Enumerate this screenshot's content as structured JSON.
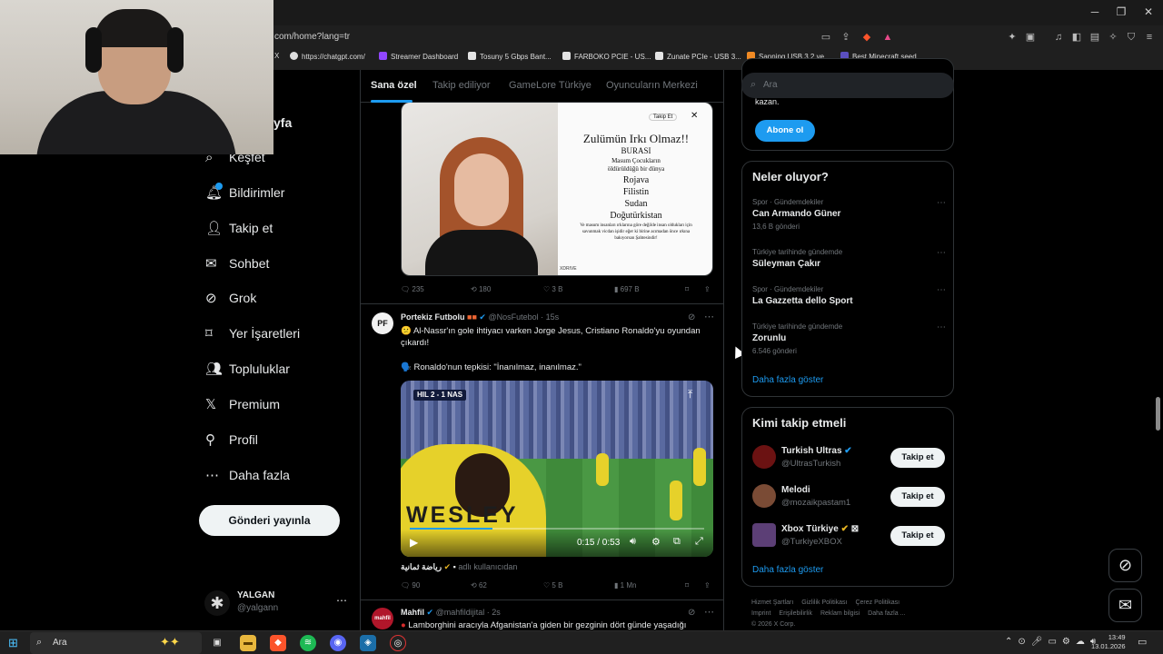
{
  "browser": {
    "url": "com/home?lang=tr",
    "bookmarks": [
      {
        "label": "X",
        "color": "#222222"
      },
      {
        "label": "https://chatgpt.com/",
        "color": "#10a37f"
      },
      {
        "label": "Streamer Dashboard",
        "color": "#9146ff"
      },
      {
        "label": "Tosuny 5 Gbps Bant...",
        "color": "#e3e3e3"
      },
      {
        "label": "FARBOKO PCIE - US...",
        "color": "#e3e3e3"
      },
      {
        "label": "Zunate PCIe - USB 3...",
        "color": "#e3e3e3"
      },
      {
        "label": "Sanning USB 3.2 ve...",
        "color": "#f08a24"
      },
      {
        "label": "Best Minecraft seed...",
        "color": "#5b4fbf"
      }
    ]
  },
  "nav": {
    "partial_label": "yfa",
    "items": [
      {
        "label": "Keşfet",
        "icon": "search-icon",
        "glyph": "⌕"
      },
      {
        "label": "Bildirimler",
        "icon": "bell-icon",
        "glyph": "🔔︎"
      },
      {
        "label": "Takip et",
        "icon": "follow-icon",
        "glyph": "👤︎"
      },
      {
        "label": "Sohbet",
        "icon": "mail-icon",
        "glyph": "✉"
      },
      {
        "label": "Grok",
        "icon": "grok-icon",
        "glyph": "⊘"
      },
      {
        "label": "Yer İşaretleri",
        "icon": "bookmark-icon",
        "glyph": "⌑"
      },
      {
        "label": "Topluluklar",
        "icon": "communities-icon",
        "glyph": "👥︎"
      },
      {
        "label": "Premium",
        "icon": "x-logo-icon",
        "glyph": "𝕏"
      },
      {
        "label": "Profil",
        "icon": "profile-icon",
        "glyph": "⚲"
      },
      {
        "label": "Daha fazla",
        "icon": "more-icon",
        "glyph": "⋯"
      }
    ],
    "post_button": "Gönderi yayınla",
    "account": {
      "name": "YALGAN",
      "handle": "@yalgann"
    }
  },
  "feed": {
    "tabs": [
      "Sana özel",
      "Takip ediliyor",
      "GameLore Türkiye",
      "Oyuncuların Merkezi"
    ],
    "post1": {
      "image_text": {
        "title": "Zulümün Irkı Olmaz!!",
        "lines": [
          "BURASI",
          "Masum Çocukların",
          "öldürüldüğü bir dünya",
          "Rojava",
          "Filistin",
          "Sudan",
          "Doğutürkistan"
        ],
        "foot": "Ve masum insanları ırklarına göre değilde insan oldukları için savunmak vicdan işidir eğer ki birine acımadan önce ırkına bakıyorsan Şahtesindir!",
        "follow": "Takip Et",
        "watermark": "XDRIVE"
      },
      "stats": {
        "replies": "235",
        "reposts": "180",
        "likes": "3 B",
        "views": "697 B"
      }
    },
    "post2": {
      "name": "Portekiz Futbolu",
      "handle": "@NosFutebol",
      "time": "15s",
      "text1": "😕 Al-Nassr'ın gole ihtiyacı varken Jorge Jesus, Cristiano Ronaldo'yu oyundan çıkardı!",
      "text2": "🗣️ Ronaldo'nun tepkisi: \"İnanılmaz, inanılmaz.\"",
      "video": {
        "score": "HIL 2 - 1 NAS",
        "jersey": "WESLEY",
        "time": "0:15 / 0:53"
      },
      "reply_context": "رياضة ثمانية",
      "reply_handle": "adlı kullanıcıdan",
      "stats": {
        "replies": "90",
        "reposts": "62",
        "likes": "5 B",
        "views": "1 Mn"
      }
    },
    "post3": {
      "name": "Mahfil",
      "handle": "@mahfildijital",
      "time": "2s",
      "text": "Lamborghini aracıyla Afganistan'a giden bir gezginin dört günde yaşadığı"
    }
  },
  "sidebar": {
    "search_placeholder": "Ara",
    "premium_partial": "kazan.",
    "subscribe": "Abone ol",
    "trends_title": "Neler oluyor?",
    "trends": [
      {
        "category": "Spor · Gündemdekiler",
        "name": "Can Armando Güner",
        "count": "13,6 B gönderi"
      },
      {
        "category": "Türkiye tarihinde gündemde",
        "name": "Süleyman Çakır",
        "count": ""
      },
      {
        "category": "Spor · Gündemdekiler",
        "name": "La Gazzetta dello Sport",
        "count": ""
      },
      {
        "category": "Türkiye tarihinde gündemde",
        "name": "Zorunlu",
        "count": "6.546 gönderi"
      }
    ],
    "show_more": "Daha fazla göster",
    "who_title": "Kimi takip etmeli",
    "who": [
      {
        "name": "Turkish Ultras",
        "handle": "@UltrasTurkish",
        "button": "Takip et",
        "color": "#6b1212"
      },
      {
        "name": "Melodi",
        "handle": "@mozaikpastam1",
        "button": "Takip et",
        "color": "#7a4b35"
      },
      {
        "name": "Xbox Türkiye",
        "handle": "@TurkiyeXBOX",
        "button": "Takip et",
        "color": "#5c3f76"
      }
    ],
    "who_more": "Daha fazla göster",
    "footer": [
      "Hizmet Şartları",
      "Gizlilik Politikası",
      "Çerez Politikası",
      "Imprint",
      "Erişilebilirlik",
      "Reklam bilgisi",
      "Daha fazla ...",
      "© 2026 X Corp."
    ]
  },
  "taskbar": {
    "search": "Ara",
    "time": "13:49",
    "date": "13.01.2026"
  }
}
